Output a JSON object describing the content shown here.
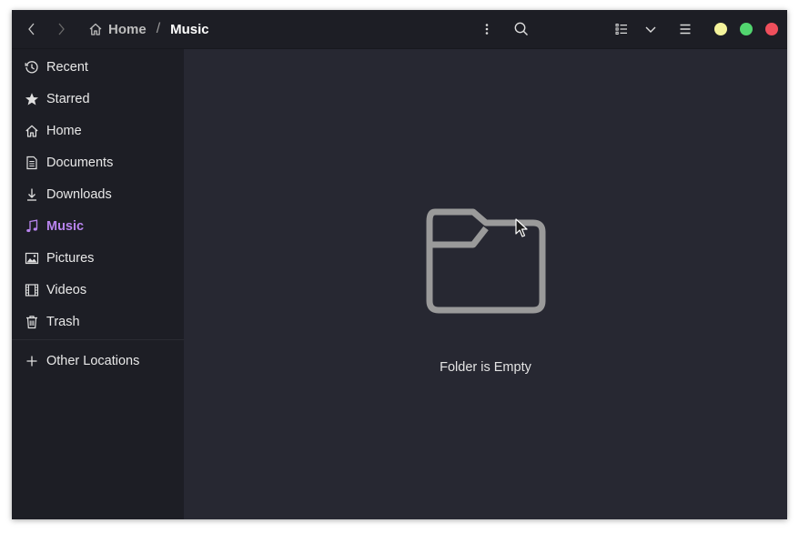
{
  "breadcrumb": {
    "home_label": "Home",
    "separator": "/",
    "current_label": "Music"
  },
  "sidebar": {
    "items": [
      {
        "label": "Recent",
        "icon": "clock-icon"
      },
      {
        "label": "Starred",
        "icon": "star-icon"
      },
      {
        "label": "Home",
        "icon": "home-icon"
      },
      {
        "label": "Documents",
        "icon": "document-icon"
      },
      {
        "label": "Downloads",
        "icon": "download-icon"
      },
      {
        "label": "Music",
        "icon": "music-note-icon",
        "active": true
      },
      {
        "label": "Pictures",
        "icon": "picture-icon"
      },
      {
        "label": "Videos",
        "icon": "film-icon"
      },
      {
        "label": "Trash",
        "icon": "trash-icon"
      }
    ],
    "other_locations": {
      "label": "Other Locations",
      "icon": "plus-icon"
    }
  },
  "main": {
    "empty_label": "Folder is Empty",
    "empty_icon": "folder-icon"
  },
  "colors": {
    "accent": "#b884ee",
    "minimize": "#f4f39b",
    "maximize": "#52d56f",
    "close": "#ef4f5c"
  }
}
